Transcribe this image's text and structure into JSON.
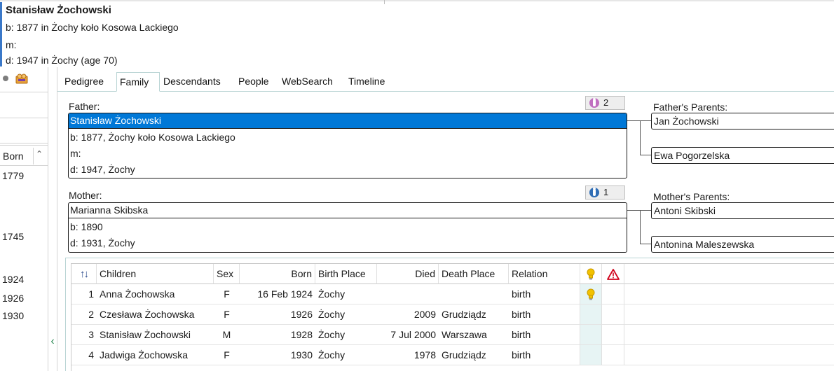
{
  "header": {
    "name": "Stanisław Żochowski",
    "birth": "b: 1877 in Żochy koło Kosowa Lackiego",
    "marriage": "m:",
    "death": "d: 1947 in Żochy (age 70)"
  },
  "left_list": {
    "column_header": "Born",
    "years": [
      "1779",
      "1745",
      "1924",
      "1926",
      "1930"
    ]
  },
  "tabs": [
    {
      "label": "Pedigree"
    },
    {
      "label": "Family"
    },
    {
      "label": "Descendants"
    },
    {
      "label": "People"
    },
    {
      "label": "WebSearch"
    },
    {
      "label": "Timeline"
    }
  ],
  "father": {
    "label": "Father:",
    "name": "Stanisław Żochowski",
    "birth": "b: 1877, Żochy koło Kosowa Lackiego",
    "marriage": "m:",
    "death": "d: 1947, Żochy",
    "spouse_count": "2"
  },
  "mother": {
    "label": "Mother:",
    "name": "Marianna Skibska",
    "birth": "b: 1890",
    "death": "d: 1931, Żochy",
    "spouse_count": "1"
  },
  "fathers_parents": {
    "label": "Father's Parents:",
    "father": "Jan Żochowski",
    "mother": "Ewa Pogorzelska"
  },
  "mothers_parents": {
    "label": "Mother's Parents:",
    "father": "Antoni Skibski",
    "mother": "Antonina Maleszewska"
  },
  "children": {
    "columns": {
      "children": "Children",
      "sex": "Sex",
      "born": "Born",
      "birth_place": "Birth Place",
      "died": "Died",
      "death_place": "Death Place",
      "relation": "Relation"
    },
    "rows": [
      {
        "num": "1",
        "name": "Anna Żochowska",
        "sex": "F",
        "born": "16 Feb 1924",
        "birth_place": "Żochy",
        "died": "",
        "death_place": "",
        "relation": "birth",
        "has_note": true
      },
      {
        "num": "2",
        "name": "Czesława Żochowska",
        "sex": "F",
        "born": "1926",
        "birth_place": "Żochy",
        "died": "2009",
        "death_place": "Grudziądz",
        "relation": "birth",
        "has_note": false
      },
      {
        "num": "3",
        "name": "Stanisław Żochowski",
        "sex": "M",
        "born": "1928",
        "birth_place": "Żochy",
        "died": "7 Jul 2000",
        "death_place": "Warszawa",
        "relation": "birth",
        "has_note": false
      },
      {
        "num": "4",
        "name": "Jadwiga Żochowska",
        "sex": "F",
        "born": "1930",
        "birth_place": "Żochy",
        "died": "1978",
        "death_place": "Grudziądz",
        "relation": "birth",
        "has_note": false
      }
    ]
  },
  "icons": {
    "father_badge": "male-spouse-icon",
    "mother_badge": "female-spouse-icon",
    "note_column": "lightbulb-icon",
    "warning_column": "warning-icon",
    "sort": "sort-arrows-icon"
  },
  "colors": {
    "selection": "#0078d7",
    "accent_bar": "#3a78c8",
    "tab_border": "#b9d4d4",
    "bulb": "#f2c200",
    "warning": "#d0021b",
    "male_badge": "#2f6db5",
    "female_badge": "#c070c0"
  }
}
